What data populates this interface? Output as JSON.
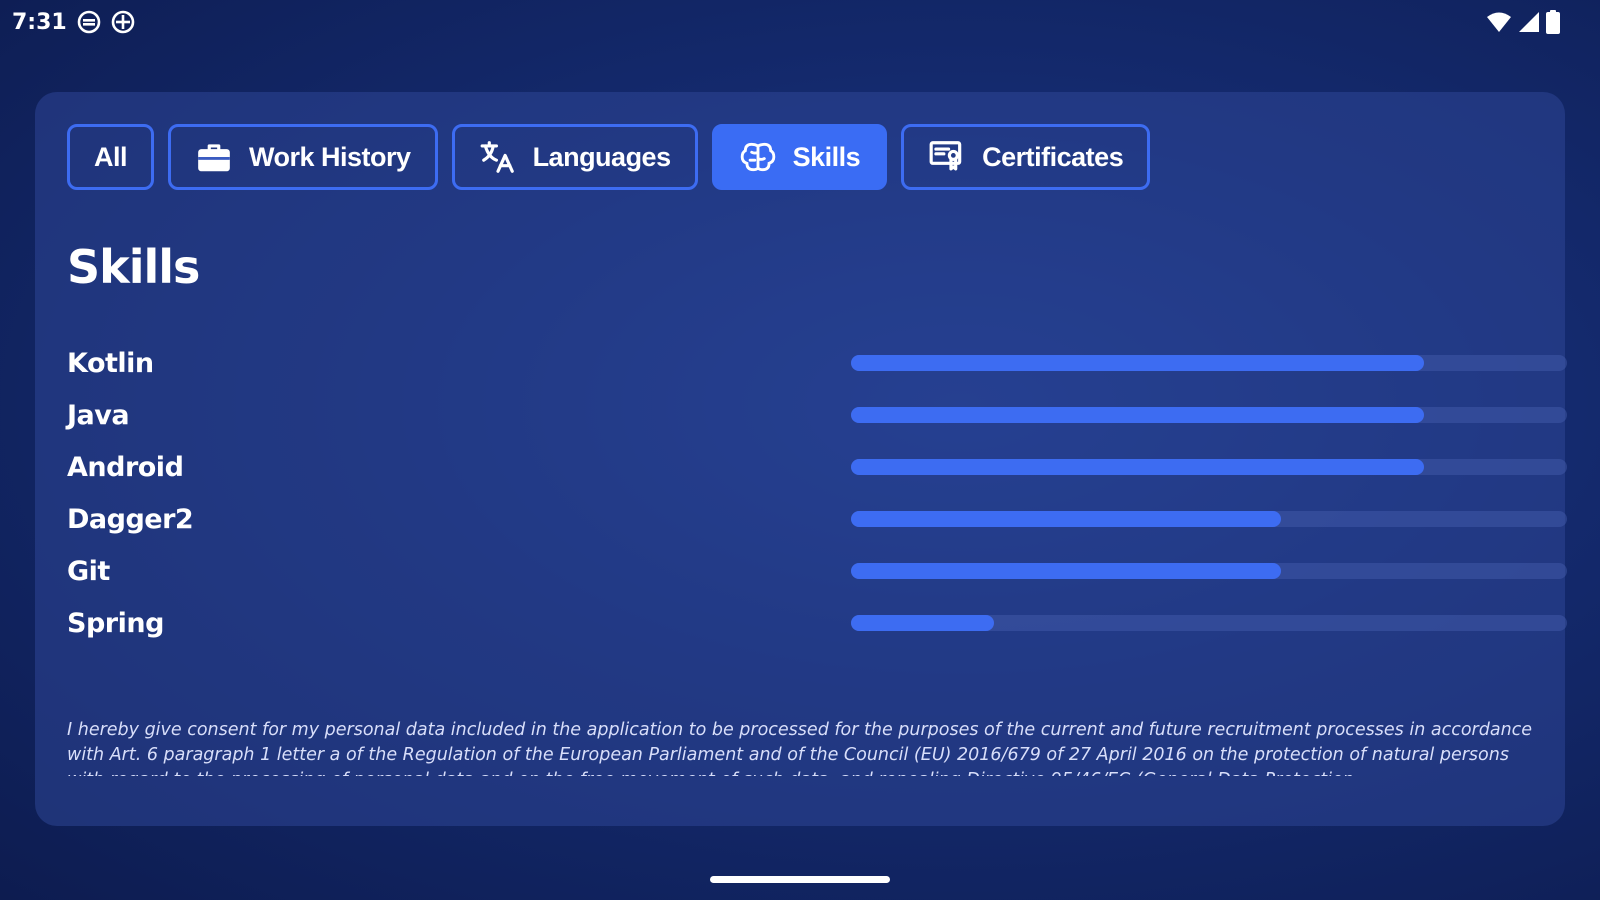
{
  "status_bar": {
    "time": "7:31",
    "left_icons": [
      "notification-icon",
      "notification-icon"
    ],
    "right_icons": [
      "wifi-icon",
      "signal-icon",
      "battery-icon"
    ]
  },
  "filters": [
    {
      "label": "All",
      "icon": "",
      "active": false
    },
    {
      "label": "Work History",
      "icon": "briefcase-icon",
      "active": false
    },
    {
      "label": "Languages",
      "icon": "translate-icon",
      "active": false
    },
    {
      "label": "Skills",
      "icon": "brain-icon",
      "active": true
    },
    {
      "label": "Certificates",
      "icon": "certificate-icon",
      "active": false
    }
  ],
  "section": {
    "title": "Skills"
  },
  "skills": [
    {
      "name": "Kotlin",
      "level": 0.8
    },
    {
      "name": "Java",
      "level": 0.8
    },
    {
      "name": "Android",
      "level": 0.8
    },
    {
      "name": "Dagger2",
      "level": 0.6
    },
    {
      "name": "Git",
      "level": 0.6
    },
    {
      "name": "Spring",
      "level": 0.2
    }
  ],
  "consent_text": "I hereby give consent for my personal data included in the application to be processed for the purposes of the current and future recruitment processes in accordance with Art. 6 paragraph 1 letter a of the Regulation of the European Parliament and of the Council (EU) 2016/679 of 27 April 2016 on the protection of natural persons with regard to the processing of personal data and on the free movement of such data, and repealing Directive 95/46/EC (General Data Protection",
  "colors": {
    "accent": "#3d6cf2",
    "track": "#2b3f86",
    "background": "#142a6e"
  }
}
